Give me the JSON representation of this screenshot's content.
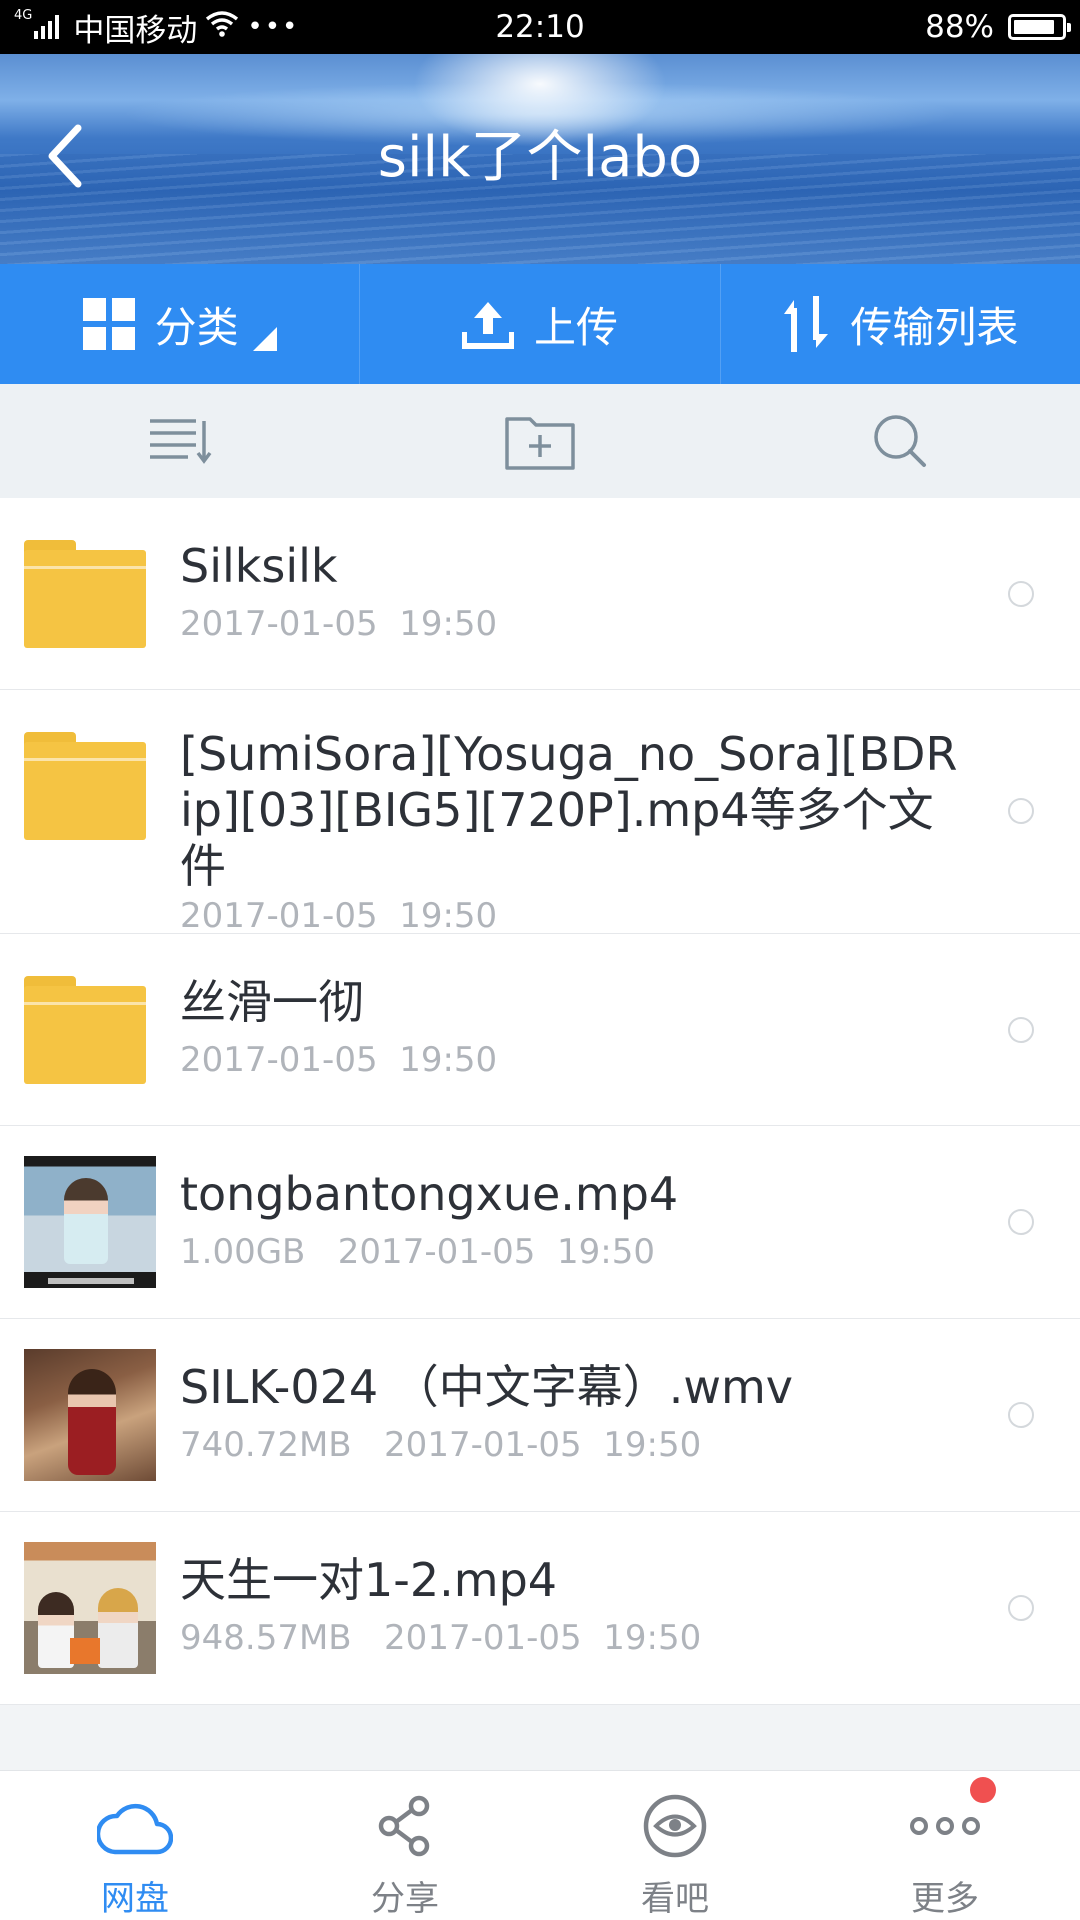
{
  "status_bar": {
    "network": "4G",
    "carrier": "中国移动",
    "more_dots": "•••",
    "time": "22:10",
    "battery": "88%",
    "battery_level": 0.88
  },
  "header": {
    "title": "silk了个labo",
    "back_icon": "chevron-left-icon"
  },
  "toolbar": {
    "category_label": "分类",
    "upload_label": "上传",
    "transfer_label": "传输列表"
  },
  "subbar": {
    "icons": [
      "sort-icon",
      "new-folder-icon",
      "search-icon"
    ]
  },
  "files": [
    {
      "type": "folder",
      "name": "Silksilk",
      "meta": "2017-01-05  19:50"
    },
    {
      "type": "folder",
      "name": "[SumiSora][Yosuga_no_Sora][BDRip][03][BIG5][720P].mp4等多个文件",
      "meta": "2017-01-05  19:50"
    },
    {
      "type": "folder",
      "name": "丝滑一彻",
      "meta": "2017-01-05  19:50"
    },
    {
      "type": "video",
      "name": "tongbantongxue.mp4",
      "meta": "1.00GB   2017-01-05  19:50"
    },
    {
      "type": "video",
      "name": "SILK-024 （中文字幕）.wmv",
      "meta": "740.72MB   2017-01-05  19:50"
    },
    {
      "type": "video",
      "name": "天生一对1-2.mp4",
      "meta": "948.57MB   2017-01-05  19:50"
    }
  ],
  "bottom_nav": [
    {
      "label": "网盘",
      "icon": "cloud-icon",
      "active": true
    },
    {
      "label": "分享",
      "icon": "share-icon",
      "active": false
    },
    {
      "label": "看吧",
      "icon": "eye-icon",
      "active": false
    },
    {
      "label": "更多",
      "icon": "more-icon",
      "active": false,
      "badge": true
    }
  ],
  "colors": {
    "accent": "#2f8cf2",
    "folder": "#f5c443",
    "badge": "#f05050"
  }
}
